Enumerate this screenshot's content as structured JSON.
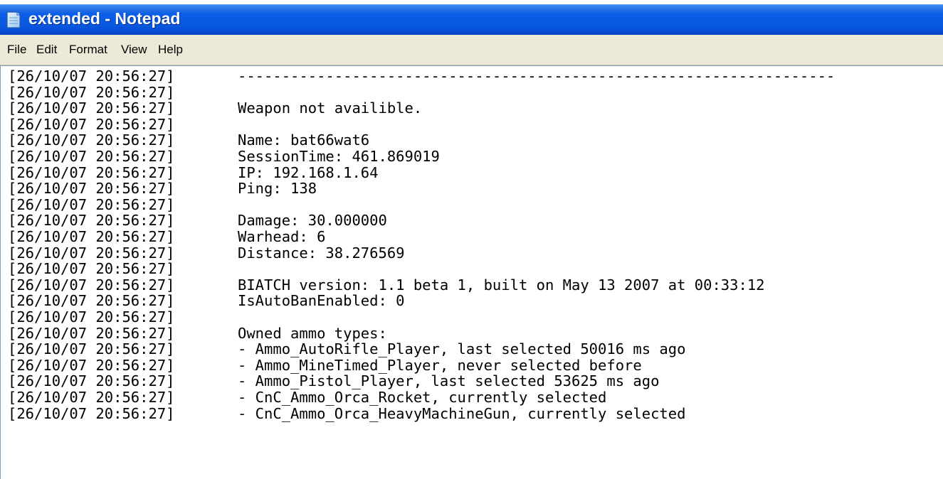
{
  "window": {
    "title": "extended - Notepad"
  },
  "menu": {
    "items": [
      "File",
      "Edit",
      "Format",
      "View",
      "Help"
    ]
  },
  "icons": {
    "app": "notepad-icon"
  },
  "document": {
    "lines": [
      {
        "ts": "[26/10/07 20:56:27]",
        "msg": "--------------------------------------------------------------------"
      },
      {
        "ts": "[26/10/07 20:56:27]",
        "msg": ""
      },
      {
        "ts": "[26/10/07 20:56:27]",
        "msg": "Weapon not availible."
      },
      {
        "ts": "[26/10/07 20:56:27]",
        "msg": ""
      },
      {
        "ts": "[26/10/07 20:56:27]",
        "msg": "Name: bat66wat6"
      },
      {
        "ts": "[26/10/07 20:56:27]",
        "msg": "SessionTime: 461.869019"
      },
      {
        "ts": "[26/10/07 20:56:27]",
        "msg": "IP: 192.168.1.64"
      },
      {
        "ts": "[26/10/07 20:56:27]",
        "msg": "Ping: 138"
      },
      {
        "ts": "[26/10/07 20:56:27]",
        "msg": ""
      },
      {
        "ts": "[26/10/07 20:56:27]",
        "msg": "Damage: 30.000000"
      },
      {
        "ts": "[26/10/07 20:56:27]",
        "msg": "Warhead: 6"
      },
      {
        "ts": "[26/10/07 20:56:27]",
        "msg": "Distance: 38.276569"
      },
      {
        "ts": "[26/10/07 20:56:27]",
        "msg": ""
      },
      {
        "ts": "[26/10/07 20:56:27]",
        "msg": "BIATCH version: 1.1 beta 1, built on May 13 2007 at 00:33:12"
      },
      {
        "ts": "[26/10/07 20:56:27]",
        "msg": "IsAutoBanEnabled: 0"
      },
      {
        "ts": "[26/10/07 20:56:27]",
        "msg": ""
      },
      {
        "ts": "[26/10/07 20:56:27]",
        "msg": "Owned ammo types:"
      },
      {
        "ts": "[26/10/07 20:56:27]",
        "msg": "- Ammo_AutoRifle_Player, last selected 50016 ms ago"
      },
      {
        "ts": "[26/10/07 20:56:27]",
        "msg": "- Ammo_MineTimed_Player, never selected before"
      },
      {
        "ts": "[26/10/07 20:56:27]",
        "msg": "- Ammo_Pistol_Player, last selected 53625 ms ago"
      },
      {
        "ts": "[26/10/07 20:56:27]",
        "msg": "- CnC_Ammo_Orca_Rocket, currently selected"
      },
      {
        "ts": "[26/10/07 20:56:27]",
        "msg": "- CnC_Ammo_Orca_HeavyMachineGun, currently selected"
      }
    ]
  }
}
